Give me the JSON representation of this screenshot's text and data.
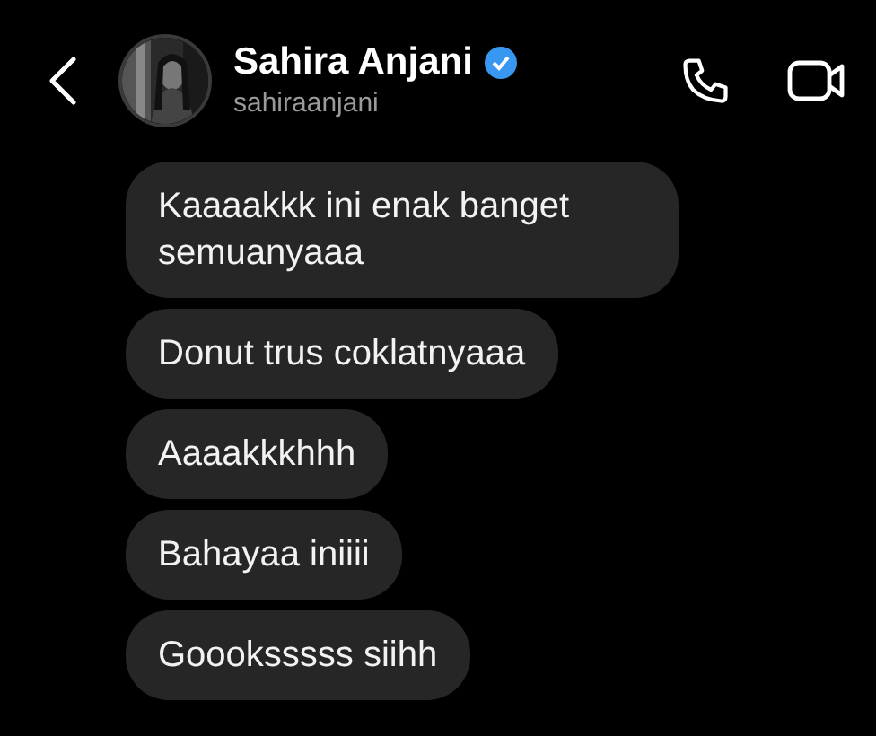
{
  "header": {
    "name": "Sahira Anjani",
    "verified": true,
    "username": "sahiraanjani"
  },
  "messages": [
    {
      "text": "Kaaaakkk ini enak banget semuanyaaa"
    },
    {
      "text": "Donut trus coklatnyaaa"
    },
    {
      "text": "Aaaakkkhhh"
    },
    {
      "text": "Bahayaa iniiii"
    },
    {
      "text": "Goooksssss siihh"
    }
  ]
}
